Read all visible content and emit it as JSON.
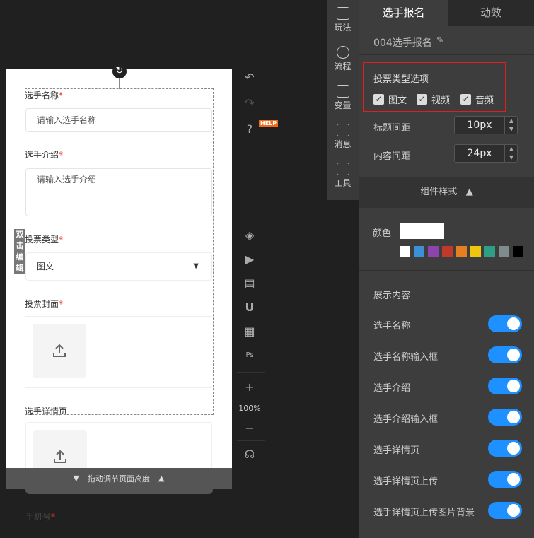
{
  "form": {
    "name_label": "选手名称",
    "name_placeholder": "请输入选手名称",
    "intro_label": "选手介绍",
    "intro_placeholder": "请输入选手介绍",
    "vote_type_label": "投票类型",
    "vote_type_value": "图文",
    "cover_label": "投票封面",
    "detail_label": "选手详情页",
    "mobile_label": "手机号",
    "required_mark": "*"
  },
  "canvas": {
    "double_click_edit": "双击编辑",
    "resize_bar_label": "拖动调节页面高度",
    "zoom": "100%",
    "help_badge": "HELP"
  },
  "tools": [
    {
      "label": "玩法",
      "icon": "gameplay-icon"
    },
    {
      "label": "流程",
      "icon": "flow-icon"
    },
    {
      "label": "变量",
      "icon": "variable-icon"
    },
    {
      "label": "消息",
      "icon": "message-icon"
    },
    {
      "label": "工具",
      "icon": "toolbox-icon"
    }
  ],
  "panel": {
    "tabs": [
      "选手报名",
      "动效"
    ],
    "component_name": "004选手报名",
    "vote_options_title": "投票类型选项",
    "vote_options": [
      {
        "label": "图文",
        "checked": true
      },
      {
        "label": "视频",
        "checked": true
      },
      {
        "label": "音频",
        "checked": true
      }
    ],
    "title_spacing_label": "标题间距",
    "title_spacing_value": "10px",
    "content_spacing_label": "内容间距",
    "content_spacing_value": "24px",
    "style_header": "组件样式",
    "color_label": "颜色",
    "current_color": "#ffffff",
    "swatches": [
      "#ffffff",
      "#3d8fd6",
      "#8e44ad",
      "#c0392b",
      "#e67e22",
      "#f1c40f",
      "#2e9e84",
      "#7f8c8d",
      "#000000"
    ],
    "show_content_title": "展示内容",
    "show_items": [
      {
        "label": "选手名称",
        "on": true
      },
      {
        "label": "选手名称输入框",
        "on": true
      },
      {
        "label": "选手介绍",
        "on": true
      },
      {
        "label": "选手介绍输入框",
        "on": true
      },
      {
        "label": "选手详情页",
        "on": true
      },
      {
        "label": "选手详情页上传",
        "on": true
      },
      {
        "label": "选手详情页上传图片背景",
        "on": true
      }
    ]
  }
}
